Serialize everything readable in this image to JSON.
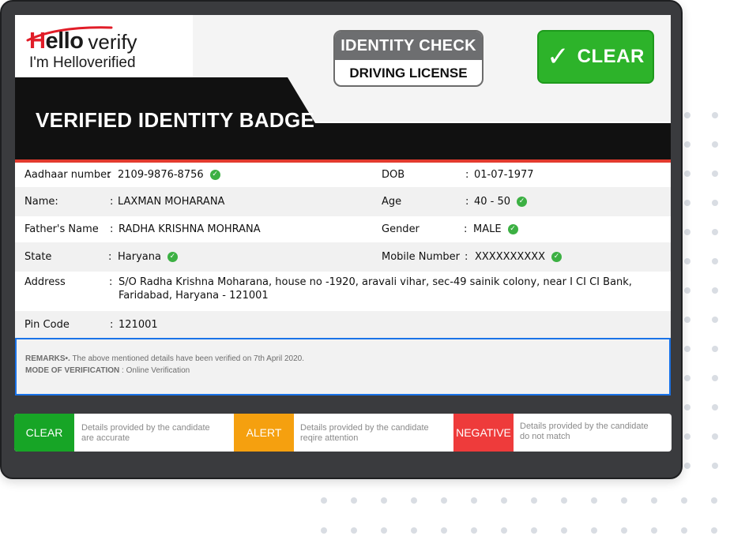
{
  "logo": {
    "brand_h": "H",
    "brand_rest": "ello",
    "brand_verify": "verify",
    "tagline": "I'm Helloverified"
  },
  "identity_check": {
    "title": "IDENTITY CHECK",
    "document": "DRIVING LICENSE"
  },
  "status_badge": {
    "label": "CLEAR",
    "check": "✓",
    "color": "#2db32a"
  },
  "banner": {
    "title": "VERIFIED IDENTITY BADGE"
  },
  "details": {
    "aadhaar": {
      "label": "Aadhaar number",
      "sep": ":",
      "value": "2109-9876-8756",
      "verified": true
    },
    "dob": {
      "label": "DOB",
      "sep": ":",
      "value": "01-07-1977"
    },
    "name": {
      "label": "Name:",
      "sep": ":",
      "value": "LAXMAN MOHARANA"
    },
    "age": {
      "label": "Age",
      "sep": ":",
      "value": "40 - 50",
      "verified": true
    },
    "father": {
      "label": "Father's Name",
      "sep": ":",
      "value": "RADHA KRISHNA MOHRANA"
    },
    "gender": {
      "label": "Gender",
      "sep": ":",
      "value": "MALE",
      "verified": true
    },
    "state": {
      "label": "State",
      "sep": ":",
      "value": "Haryana",
      "verified": true
    },
    "mobile": {
      "label": "Mobile Number",
      "sep": ":",
      "value": "XXXXXXXXXX",
      "verified": true
    },
    "address": {
      "label": "Address",
      "sep": ":",
      "line1": "S/O Radha Krishna Moharana, house no -1920, aravali vihar, sec-49 sainik colony, near I CI CI Bank,",
      "line2": "Faridabad, Haryana - 121001"
    },
    "pincode": {
      "label": "Pin Code",
      "sep": ":",
      "value": "121001"
    }
  },
  "remarks": {
    "label": "REMARKS•.",
    "text": "The above mentioned details have been verified on 7th April 2020.",
    "mode_label": "MODE OF VERIFICATION",
    "mode_value": ": Online Verification"
  },
  "legend": [
    {
      "label": "CLEAR",
      "color": "#17a526",
      "line1": "Details provided by the candidate",
      "line2": "are accurate"
    },
    {
      "label": "ALERT",
      "color": "#f5a00f",
      "line1": "Details provided by the candidate",
      "line2": "reqire attention"
    },
    {
      "label": "NEGATIVE",
      "color": "#ee3b3b",
      "line1": "Details provided by the candidate",
      "line2": "do not match"
    }
  ],
  "colors": {
    "frame": "#3a3b3e",
    "accent_red": "#e23b2e",
    "remarks_border": "#1a73e8",
    "verified_tick": "#3cb043"
  }
}
